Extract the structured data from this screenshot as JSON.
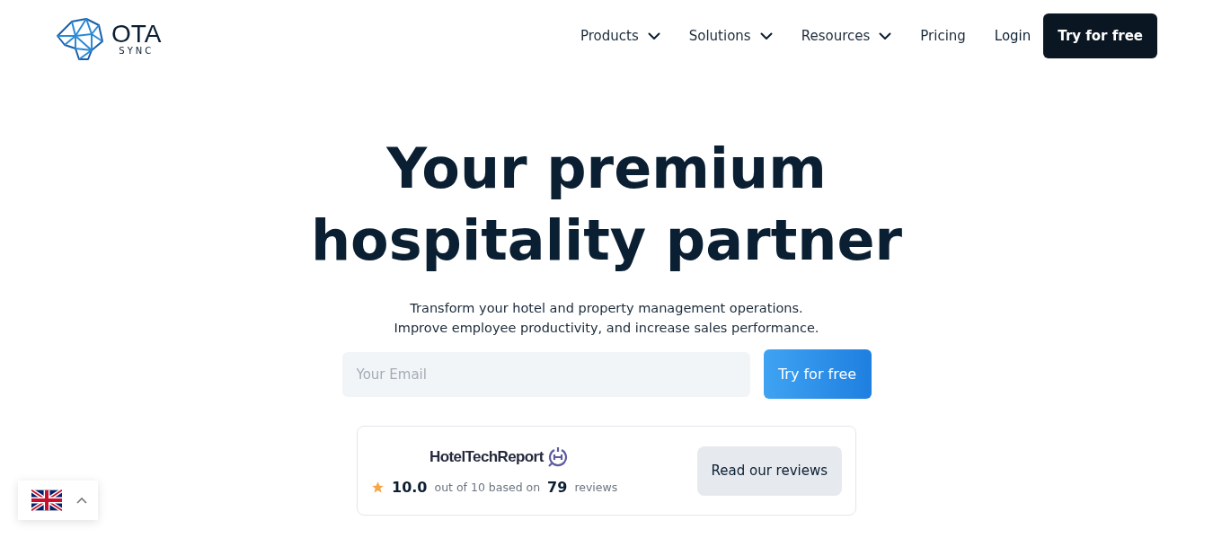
{
  "logo": {
    "name": "OTA",
    "tagline": "SYNC"
  },
  "nav": [
    {
      "label": "Products",
      "kind": "dropdown"
    },
    {
      "label": "Solutions",
      "kind": "dropdown"
    },
    {
      "label": "Resources",
      "kind": "dropdown"
    },
    {
      "label": "Pricing",
      "kind": "link"
    },
    {
      "label": "Login",
      "kind": "login"
    }
  ],
  "header_cta": "Try for free",
  "hero": {
    "title_lines": [
      "Your premium",
      "hospitality partner"
    ],
    "subtitle_lines": [
      "Transform your hotel and property management operations.",
      "Improve employee productivity, and increase sales performance."
    ],
    "email": {
      "placeholder": "Your Email"
    },
    "cta": "Try for free"
  },
  "review_card": {
    "brand": "HotelTechReport",
    "score": "10.0",
    "score_text": "out of 10 based on",
    "count": "79",
    "count_text": "reviews",
    "button": "Read our reviews"
  }
}
